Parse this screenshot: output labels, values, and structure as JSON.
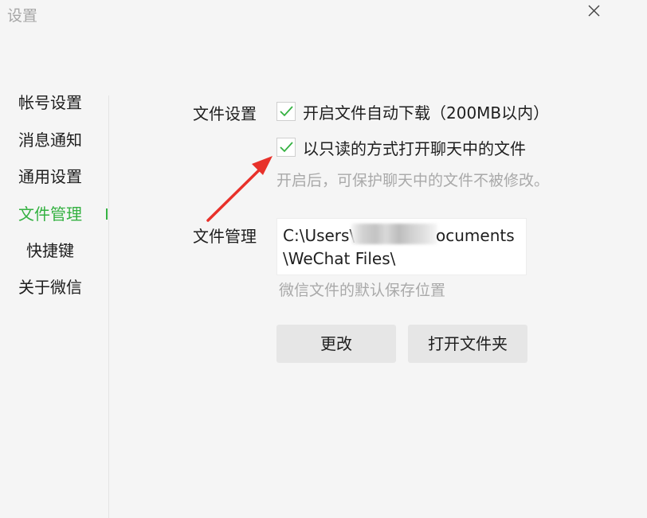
{
  "window": {
    "title": "设置"
  },
  "sidebar": {
    "items": [
      {
        "label": "帐号设置",
        "active": false
      },
      {
        "label": "消息通知",
        "active": false
      },
      {
        "label": "通用设置",
        "active": false
      },
      {
        "label": "文件管理",
        "active": true
      },
      {
        "label": "快捷键",
        "active": false
      },
      {
        "label": "关于微信",
        "active": false
      }
    ]
  },
  "file_settings": {
    "label": "文件设置",
    "auto_download": {
      "label": "开启文件自动下载（200MB以内）",
      "checked": true
    },
    "read_only": {
      "label": "以只读的方式打开聊天中的文件",
      "checked": true
    },
    "read_only_hint": "开启后，可保护聊天中的文件不被修改。"
  },
  "file_management": {
    "label": "文件管理",
    "path_line1": "C:\\Users\\",
    "path_line1_tail": "ocuments",
    "path_line2": "\\WeChat Files\\",
    "hint": "微信文件的默认保存位置",
    "change_button": "更改",
    "open_folder_button": "打开文件夹"
  },
  "colors": {
    "accent": "#34b141",
    "arrow": "#e8312a",
    "background": "#f5f5f5"
  },
  "icons": {
    "close": "close-icon",
    "check": "check-icon"
  }
}
